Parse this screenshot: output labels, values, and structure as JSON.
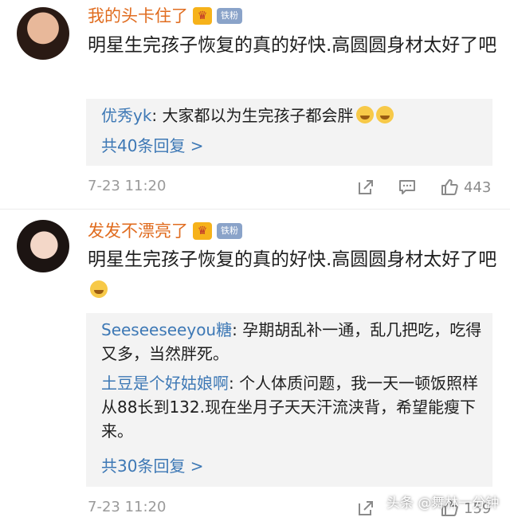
{
  "comments": [
    {
      "user": "我的头卡住了",
      "badge_fan": "铁粉",
      "text": "明星生完孩子恢复的真的好快.高圆圆身材太好了吧",
      "replies": [
        {
          "name": "优秀yk",
          "text": ": 大家都以为生完孩子都会胖"
        }
      ],
      "more": "共40条回复 >",
      "time": "7-23 11:20",
      "likes": "443"
    },
    {
      "user": "发发不漂亮了",
      "badge_fan": "铁粉",
      "text": "明星生完孩子恢复的真的好快.高圆圆身材太好了吧",
      "replies": [
        {
          "name": "Seeseeseeyou糖",
          "text": ": 孕期胡乱补一通，乱几把吃，吃得又多，当然胖死。"
        },
        {
          "name": "土豆是个好姑娘啊",
          "text": ": 个人体质问题，我一天一顿饭照样从88长到132.现在坐月子天天汗流浃背，希望能瘦下来。"
        }
      ],
      "more": "共30条回复 >",
      "time": "7-23 11:20",
      "likes": "159"
    }
  ],
  "watermark": "头条 @舞林一分钟",
  "icons": [
    "share-icon",
    "comment-icon",
    "like-icon",
    "crown-badge-icon",
    "emoji-icon"
  ],
  "colors": {
    "username": "#e06c1f",
    "reply_name": "#3d78b5",
    "reply_bg": "#f3f3f3",
    "meta": "#9a9a9a"
  }
}
